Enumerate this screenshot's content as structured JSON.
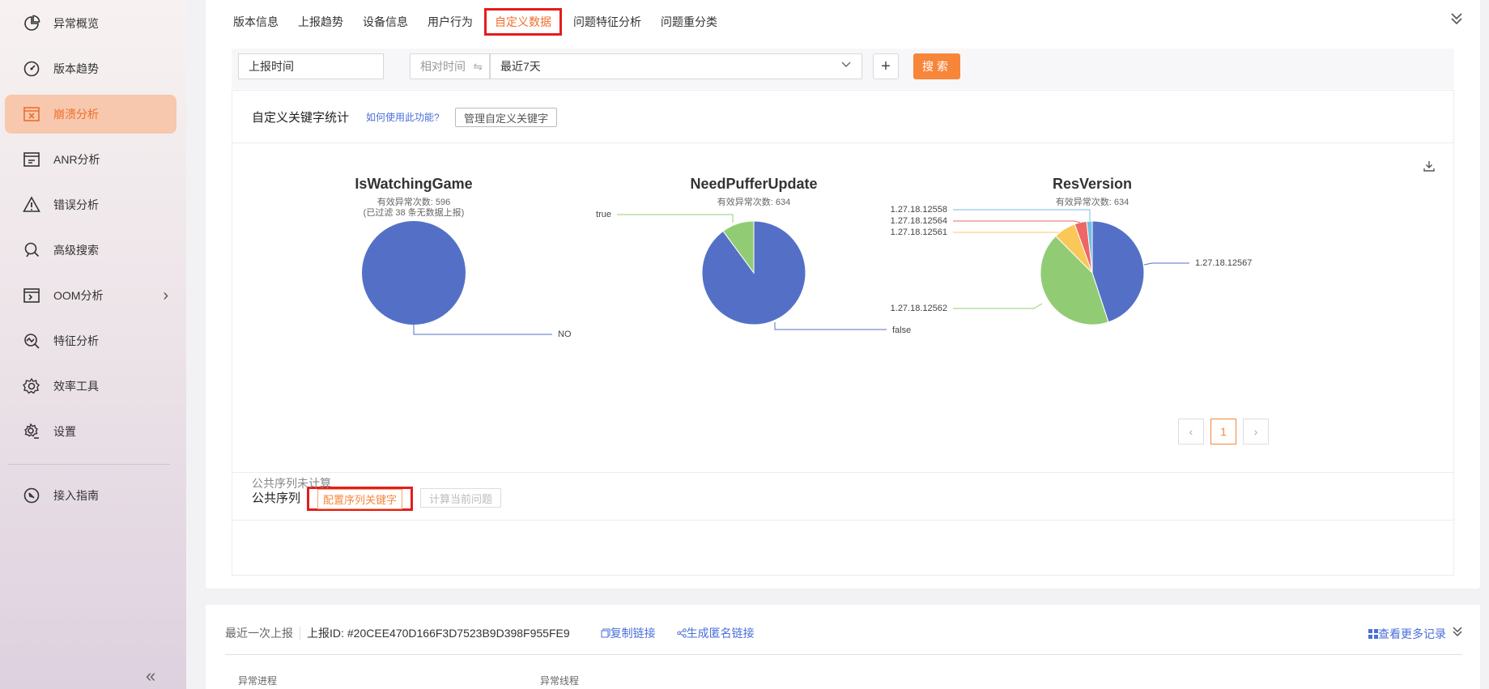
{
  "sidebar": {
    "items": [
      {
        "label": "异常概览",
        "icon": "pie-chart-icon"
      },
      {
        "label": "版本趋势",
        "icon": "gauge-icon"
      },
      {
        "label": "崩溃分析",
        "icon": "crash-window-icon",
        "active": true
      },
      {
        "label": "ANR分析",
        "icon": "anr-window-icon"
      },
      {
        "label": "错误分析",
        "icon": "warning-icon"
      },
      {
        "label": "高级搜索",
        "icon": "search-icon"
      },
      {
        "label": "OOM分析",
        "icon": "oom-window-icon",
        "has_submenu": true
      },
      {
        "label": "特征分析",
        "icon": "feature-search-icon"
      },
      {
        "label": "效率工具",
        "icon": "gear-icon"
      },
      {
        "label": "设置",
        "icon": "settings-icon"
      },
      {
        "label": "接入指南",
        "icon": "compass-icon"
      }
    ]
  },
  "tabs": [
    {
      "label": "版本信息"
    },
    {
      "label": "上报趋势"
    },
    {
      "label": "设备信息"
    },
    {
      "label": "用户行为"
    },
    {
      "label": "自定义数据",
      "active": true
    },
    {
      "label": "问题特征分析"
    },
    {
      "label": "问题重分类"
    }
  ],
  "filter": {
    "time_field": "上报时间",
    "relative": "相对时间",
    "range": "最近7天",
    "plus": "+",
    "search": "搜索"
  },
  "custom_keywords": {
    "title": "自定义关键字统计",
    "help_link": "如何使用此功能?",
    "manage_button": "管理自定义关键字"
  },
  "charts": [
    {
      "title": "IsWatchingGame",
      "subtitle": "有效异常次数: 596",
      "subtitle2": "(已过滤 38 条无数据上报)"
    },
    {
      "title": "NeedPufferUpdate",
      "subtitle": "有效异常次数: 634",
      "subtitle2": ""
    },
    {
      "title": "ResVersion",
      "subtitle": "有效异常次数: 634",
      "subtitle2": ""
    }
  ],
  "chart_data": [
    {
      "type": "pie",
      "title": "IsWatchingGame",
      "categories": [
        "NO"
      ],
      "values": [
        596
      ],
      "colors": [
        "#5470c6"
      ]
    },
    {
      "type": "pie",
      "title": "NeedPufferUpdate",
      "categories": [
        "false",
        "true"
      ],
      "values": [
        570,
        64
      ],
      "colors": [
        "#5470c6",
        "#91cc75"
      ]
    },
    {
      "type": "pie",
      "title": "ResVersion",
      "categories": [
        "1.27.18.12567",
        "1.27.18.12562",
        "1.27.18.12561",
        "1.27.18.12564",
        "1.27.18.12558"
      ],
      "values": [
        285,
        270,
        44,
        24,
        11
      ],
      "colors": [
        "#5470c6",
        "#91cc75",
        "#fac858",
        "#ee6666",
        "#73c0de"
      ]
    }
  ],
  "pager": {
    "prev": "‹",
    "current": "1",
    "next": "›"
  },
  "sequence": {
    "title": "公共序列",
    "config_button": "配置序列关键字",
    "calc_button": "计算当前问题",
    "empty_text": "公共序列未计算"
  },
  "report": {
    "last_label": "最近一次上报",
    "id_label": "上报ID:",
    "id_value": "#20CEE470D166F3D7523B9D398F955FE9",
    "copy_link": "复制链接",
    "anon_link": "生成匿名链接",
    "more_link": "查看更多记录",
    "col_process": "异常进程",
    "col_thread": "异常线程"
  },
  "colors": {
    "accent": "#ef6f2d",
    "highlight_border": "#e51c1c",
    "link": "#4a6fd8"
  }
}
